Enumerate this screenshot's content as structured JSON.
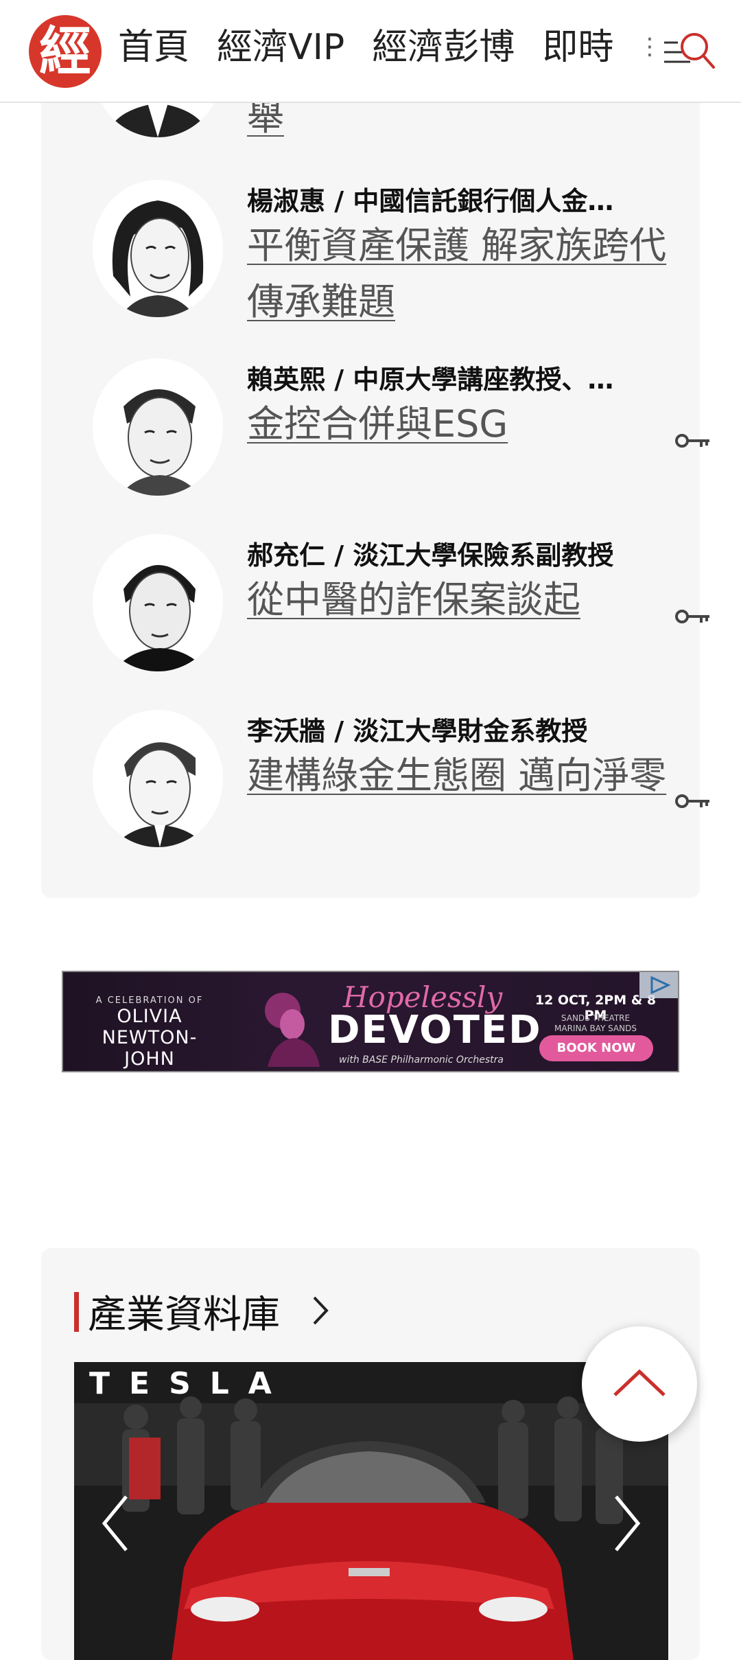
{
  "header": {
    "logo_char": "經",
    "nav": [
      "首頁",
      "經濟VIP",
      "經濟彭博",
      "即時"
    ],
    "more_glyph": "⋮"
  },
  "columnists": [
    {
      "name": "",
      "title": "舉",
      "locked": false
    },
    {
      "name": "楊淑惠 / 中國信託銀行個人金…",
      "title": "平衡資產保護 解家族跨代傳承難題",
      "locked": false
    },
    {
      "name": "賴英熙 / 中原大學講座教授、…",
      "title": "金控合併與ESG",
      "locked": true
    },
    {
      "name": "郝充仁 / 淡江大學保險系副教授",
      "title": "從中醫的詐保案談起",
      "locked": true
    },
    {
      "name": "李沃牆 / 淡江大學財金系教授",
      "title": "建構綠金生態圈 邁向淨零",
      "locked": true
    }
  ],
  "ad": {
    "small": "A CELEBRATION OF",
    "line1": "OLIVIA",
    "line2": "NEWTON-JOHN",
    "script": "Hopelessly",
    "headline": "DEVOTED",
    "with": "with BASE Philharmonic Orchestra",
    "date": "12 OCT, 2PM & 8 PM",
    "venue1": "SANDS THEATRE",
    "venue2": "MARINA BAY SANDS",
    "cta": "BOOK NOW"
  },
  "section": {
    "title": "產業資料庫",
    "brand_text": "TESLA"
  },
  "colors": {
    "brand_red": "#d7372b",
    "accent_red": "#c9302c",
    "card_bg": "#f6f6f6"
  }
}
